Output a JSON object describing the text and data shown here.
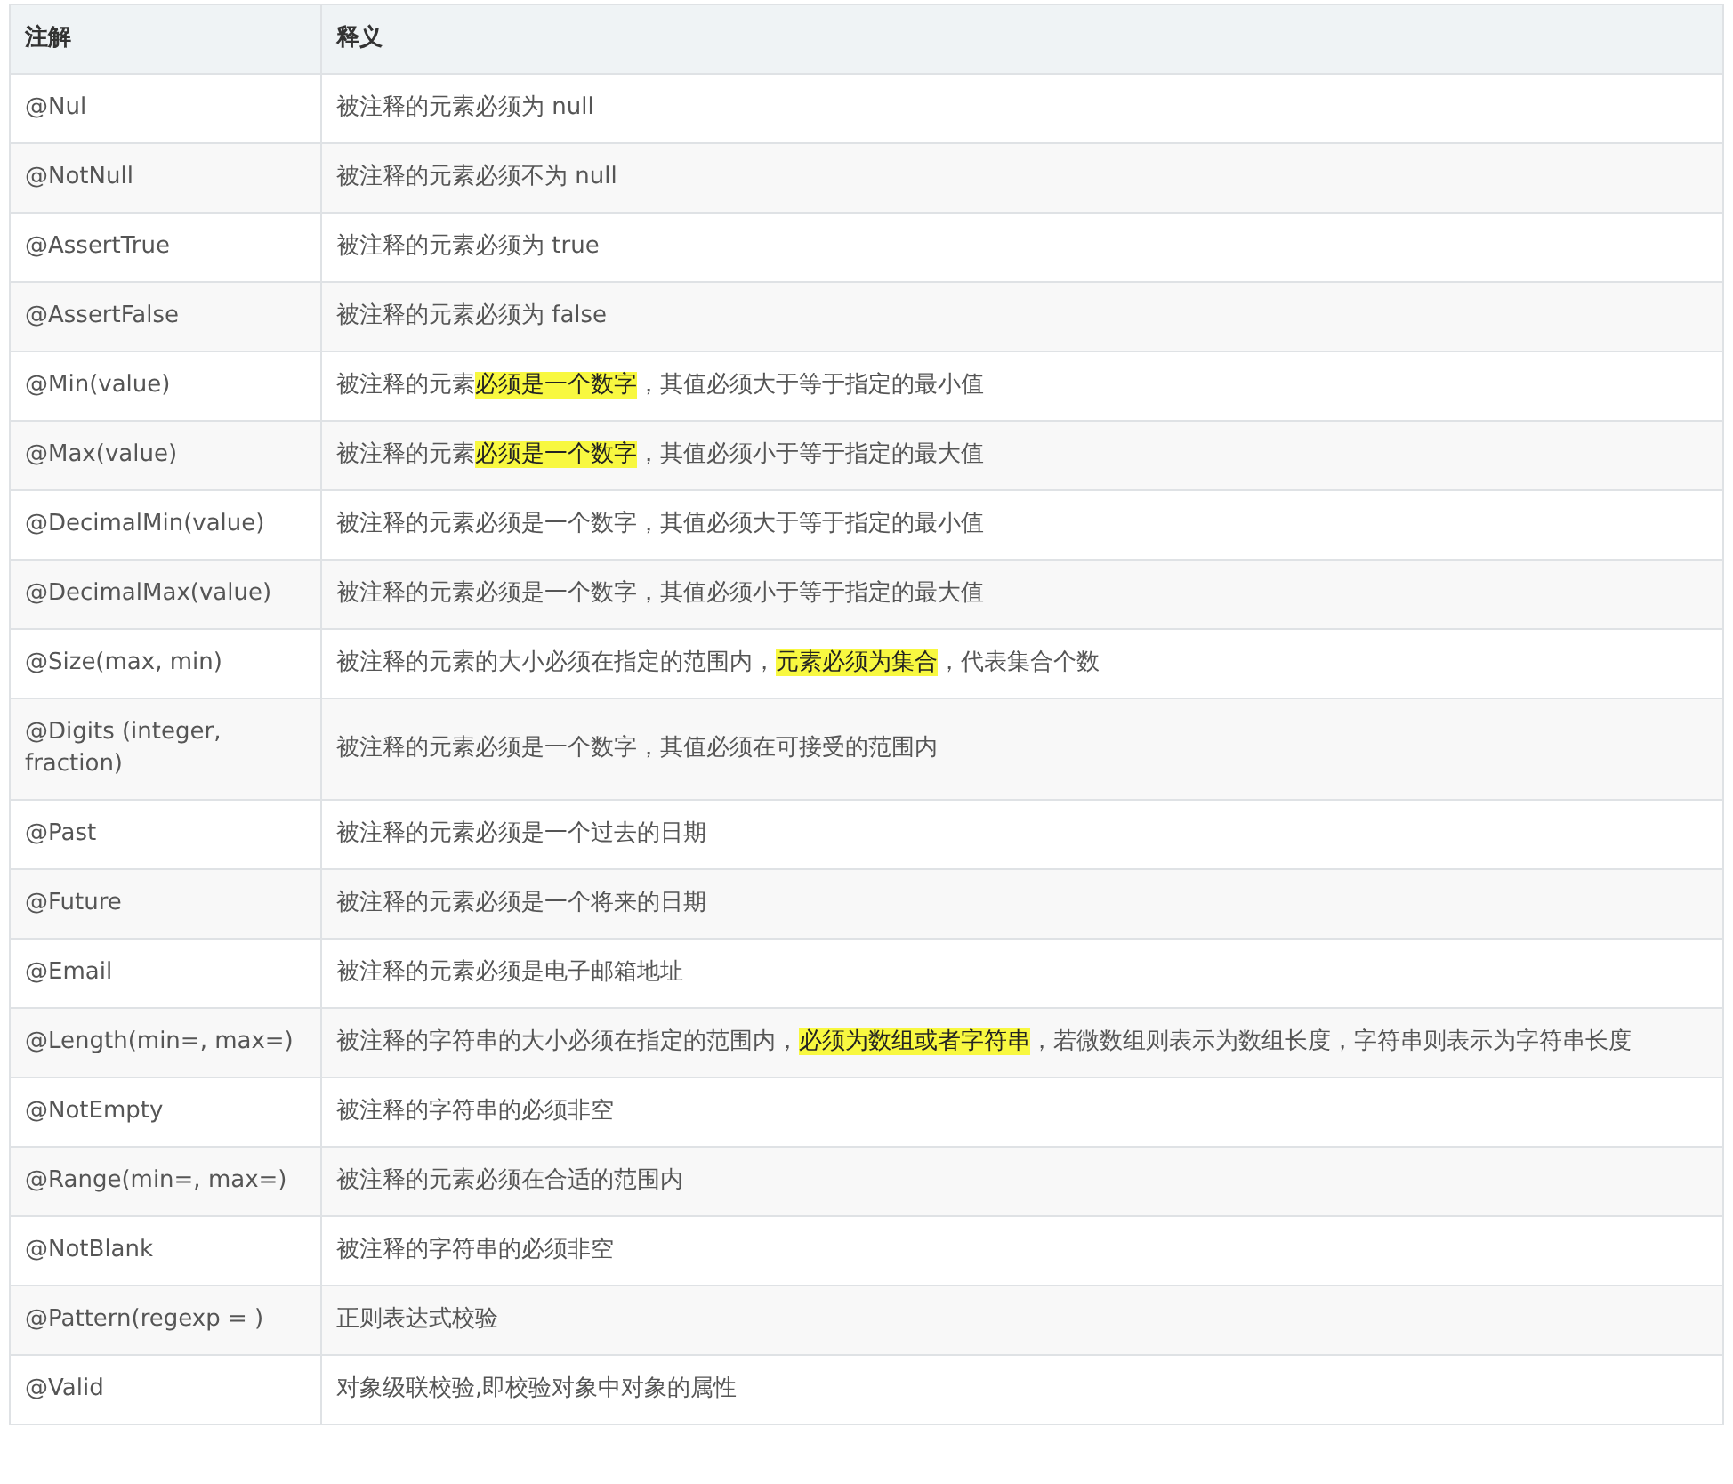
{
  "table": {
    "columns": [
      "注解",
      "释义"
    ],
    "rows": [
      {
        "annotation": "@Nul",
        "meaning": "被注释的元素必须为 null"
      },
      {
        "annotation": "@NotNull",
        "meaning": "被注释的元素必须不为 null"
      },
      {
        "annotation": "@AssertTrue",
        "meaning": "被注释的元素必须为 true"
      },
      {
        "annotation": "@AssertFalse",
        "meaning": "被注释的元素必须为 false"
      },
      {
        "annotation": "@Min(value)",
        "meaning": "被注释的元素**必须是一个数字**，其值必须大于等于指定的最小值"
      },
      {
        "annotation": "@Max(value)",
        "meaning": "被注释的元素**必须是一个数字**，其值必须小于等于指定的最大值"
      },
      {
        "annotation": "@DecimalMin(value)",
        "meaning": "被注释的元素必须是一个数字，其值必须大于等于指定的最小值"
      },
      {
        "annotation": "@DecimalMax(value)",
        "meaning": "被注释的元素必须是一个数字，其值必须小于等于指定的最大值"
      },
      {
        "annotation": "@Size(max, min)",
        "meaning": "被注释的元素的大小必须在指定的范围内，**元素必须为集合**，代表集合个数"
      },
      {
        "annotation": "@Digits (integer, fraction)",
        "meaning": "被注释的元素必须是一个数字，其值必须在可接受的范围内"
      },
      {
        "annotation": "@Past",
        "meaning": "被注释的元素必须是一个过去的日期"
      },
      {
        "annotation": "@Future",
        "meaning": "被注释的元素必须是一个将来的日期"
      },
      {
        "annotation": "@Email",
        "meaning": "被注释的元素必须是电子邮箱地址"
      },
      {
        "annotation": "@Length(min=, max=)",
        "meaning": "被注释的字符串的大小必须在指定的范围内，**必须为数组或者字符串**，若微数组则表示为数组长度，字符串则表示为字符串长度"
      },
      {
        "annotation": "@NotEmpty",
        "meaning": "被注释的字符串的必须非空"
      },
      {
        "annotation": "@Range(min=, max=)",
        "meaning": "被注释的元素必须在合适的范围内"
      },
      {
        "annotation": "@NotBlank",
        "meaning": "被注释的字符串的必须非空"
      },
      {
        "annotation": "@Pattern(regexp = )",
        "meaning": "正则表达式校验"
      },
      {
        "annotation": "@Valid",
        "meaning": "对象级联校验,即校验对象中对象的属性"
      }
    ]
  }
}
